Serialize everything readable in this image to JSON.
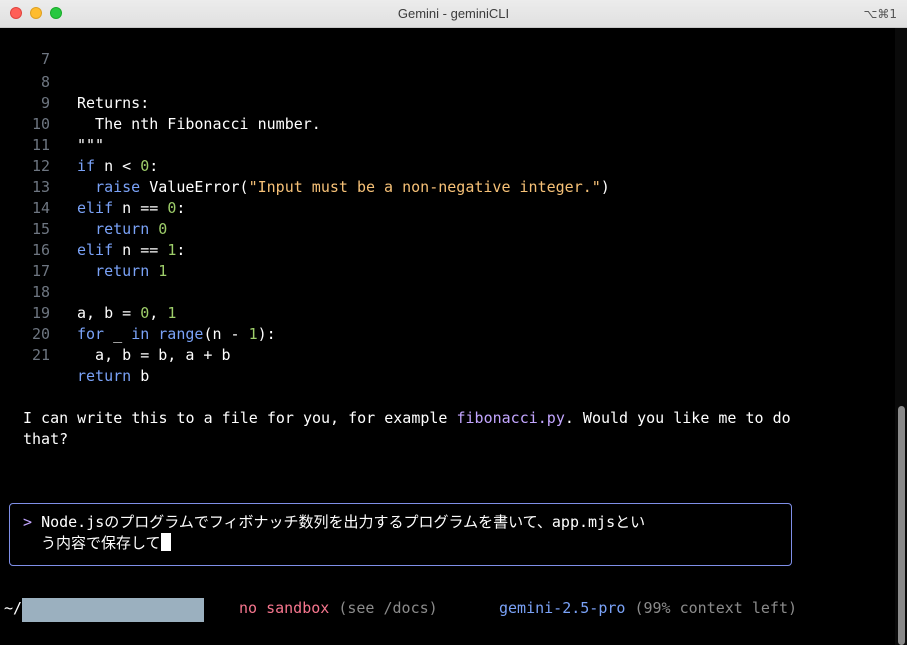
{
  "window": {
    "title": "Gemini - geminiCLI",
    "shortcut": "⌥⌘1"
  },
  "code_lines": [
    {
      "n": "7",
      "text": ""
    },
    {
      "n": "8",
      "text": "Returns:"
    },
    {
      "n": "9",
      "text": "  The nth Fibonacci number."
    },
    {
      "n": "10",
      "text": "\"\"\""
    },
    {
      "n": "11",
      "kw": "if",
      "rest": " n < ",
      "num": "0",
      "tail": ":"
    },
    {
      "n": "12",
      "indent": "  ",
      "kw": "raise",
      "rest": " ValueError(",
      "str": "\"Input must be a non-negative integer.\"",
      "tail": ")"
    },
    {
      "n": "13",
      "kw": "elif",
      "rest": " n == ",
      "num": "0",
      "tail": ":"
    },
    {
      "n": "14",
      "indent": "  ",
      "kw": "return",
      "rest": " ",
      "num": "0",
      "tail": ""
    },
    {
      "n": "15",
      "kw": "elif",
      "rest": " n == ",
      "num": "1",
      "tail": ":"
    },
    {
      "n": "16",
      "indent": "  ",
      "kw": "return",
      "rest": " ",
      "num": "1",
      "tail": ""
    },
    {
      "n": "17",
      "text": ""
    },
    {
      "n": "18",
      "text": "a, b = ",
      "num1": "0",
      "sep": ", ",
      "num2": "1"
    },
    {
      "n": "19",
      "kw": "for",
      "rest": " _ ",
      "kw2": "in",
      "rest2": " ",
      "kw3": "range",
      "rest3": "(n - ",
      "num": "1",
      "tail": "):"
    },
    {
      "n": "20",
      "text": "  a, b = b, a + b"
    },
    {
      "n": "21",
      "kw": "return",
      "rest": " b",
      "tail": ""
    }
  ],
  "assistant_message": {
    "line1_before": "I can write this to a file for you, for example ",
    "filename": "fibonacci.py",
    "line1_after": ". Would you like me to do",
    "line2": "that?"
  },
  "prompt": {
    "caret": ">",
    "line1": "Node.jsのプログラムでフィボナッチ数列を出力するプログラムを書いて、app.mjsとい",
    "line2": "う内容で保存して"
  },
  "status_bar": {
    "cwd": "~/",
    "sandbox": "no sandbox",
    "sandbox_hint": "(see /docs)",
    "model": "gemini-2.5-pro",
    "context": "(99% context left)"
  },
  "colors": {
    "keyword": "#7aa2f7",
    "number": "#9ece6a",
    "string": "#f6c177",
    "highlight": "#c3a6ff",
    "sandbox": "#f7768e",
    "model": "#7aa2f7"
  }
}
